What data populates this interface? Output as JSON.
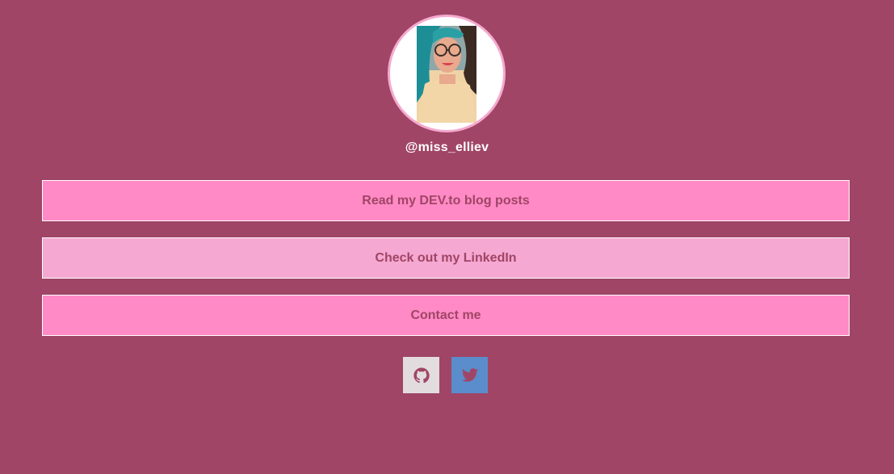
{
  "profile": {
    "username": "@miss_elliev"
  },
  "links": [
    {
      "label": "Read my DEV.to blog posts"
    },
    {
      "label": "Check out my LinkedIn"
    },
    {
      "label": "Contact me"
    }
  ],
  "social": [
    {
      "icon": "github-icon"
    },
    {
      "icon": "twitter-icon"
    }
  ],
  "colors": {
    "background": "#a04565",
    "button_primary": "#ff8ac6",
    "button_secondary": "#f5a8d1",
    "button_text": "#a04565",
    "github_tile": "#e2dcdf",
    "twitter_tile": "#5b8ccc"
  }
}
